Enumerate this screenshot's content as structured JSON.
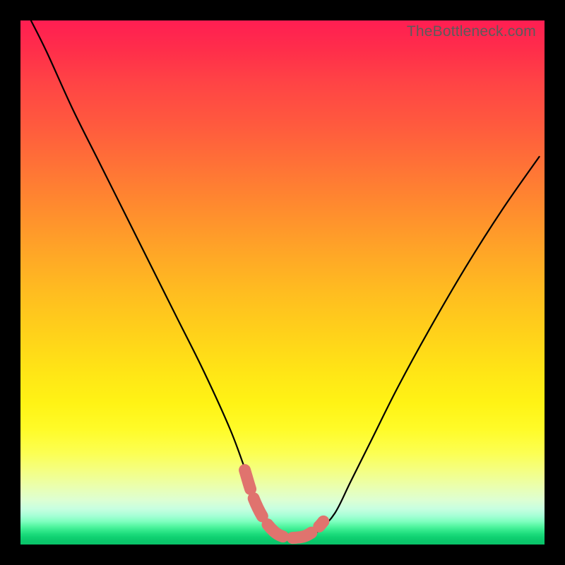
{
  "watermark": "TheBottleneck.com",
  "chart_data": {
    "type": "line",
    "title": "",
    "xlabel": "",
    "ylabel": "",
    "xlim": [
      0,
      100
    ],
    "ylim": [
      0,
      100
    ],
    "series": [
      {
        "name": "bottleneck-curve",
        "x": [
          2,
          5,
          10,
          15,
          20,
          25,
          30,
          35,
          40,
          43,
          45,
          47,
          49,
          51,
          53,
          55,
          57,
          60,
          63,
          67,
          72,
          78,
          85,
          92,
          99
        ],
        "values": [
          100,
          94,
          83,
          73,
          63,
          53,
          43,
          33,
          22,
          14,
          9,
          5,
          2.5,
          1.5,
          1.2,
          1.5,
          2.7,
          6,
          12,
          20,
          30,
          41,
          53,
          64,
          74
        ]
      }
    ],
    "highlight_segment": {
      "name": "optimal-zone",
      "x": [
        42.8,
        44.5,
        46.5,
        48.5,
        50.5,
        52.5,
        54.5,
        56.5,
        57.8
      ],
      "values": [
        14.2,
        8.8,
        4.8,
        2.4,
        1.4,
        1.3,
        1.7,
        3.0,
        4.4
      ]
    },
    "colors": {
      "curve": "#000000",
      "highlight": "#e0736e",
      "gradient_top": "#ff1e52",
      "gradient_mid": "#ffe516",
      "gradient_bottom": "#09c369"
    }
  }
}
